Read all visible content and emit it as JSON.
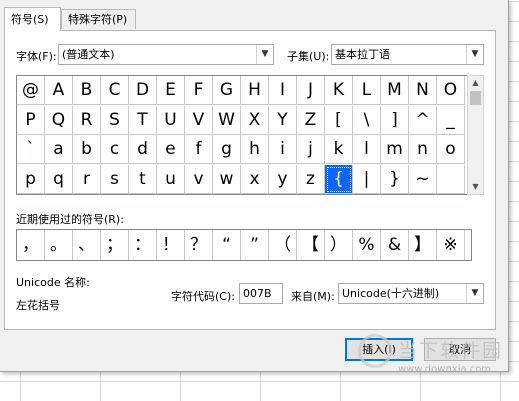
{
  "tabs": [
    {
      "label": "符号(S)",
      "active": true
    },
    {
      "label": "特殊字符(P)",
      "active": false
    }
  ],
  "font": {
    "label": "字体(F):",
    "value": "(普通文本)"
  },
  "subset": {
    "label": "子集(U):",
    "value": "基本拉丁语"
  },
  "symbol_rows": [
    [
      "@",
      "A",
      "B",
      "C",
      "D",
      "E",
      "F",
      "G",
      "H",
      "I",
      "J",
      "K",
      "L",
      "M",
      "N",
      "O"
    ],
    [
      "P",
      "Q",
      "R",
      "S",
      "T",
      "U",
      "V",
      "W",
      "X",
      "Y",
      "Z",
      "[",
      "\\",
      "]",
      "^",
      "_"
    ],
    [
      "`",
      "a",
      "b",
      "c",
      "d",
      "e",
      "f",
      "g",
      "h",
      "i",
      "j",
      "k",
      "l",
      "m",
      "n",
      "o"
    ],
    [
      "p",
      "q",
      "r",
      "s",
      "t",
      "u",
      "v",
      "w",
      "x",
      "y",
      "z",
      "{",
      "|",
      "}",
      "~",
      ""
    ]
  ],
  "selected_symbol": "{",
  "recent": {
    "label": "近期使用过的符号(R):",
    "symbols": [
      "，",
      "。",
      "、",
      "；",
      "：",
      "！",
      "？",
      "“",
      "”",
      "（",
      "【",
      "）",
      "%",
      "&",
      "】",
      "※"
    ]
  },
  "unicode_name_label": "Unicode 名称:",
  "unicode_name_value": "左花括号",
  "char_code": {
    "label": "字符代码(C):",
    "value": "007B"
  },
  "from": {
    "label": "来自(M):",
    "value": "Unicode(十六进制)"
  },
  "buttons": {
    "insert": "插入(I)",
    "cancel": "取消"
  },
  "watermark": {
    "text": "当下软件园",
    "url": "www.downxia.com"
  },
  "colors": {
    "selection": "#0a66ff",
    "focus_border": "#0078d7"
  }
}
